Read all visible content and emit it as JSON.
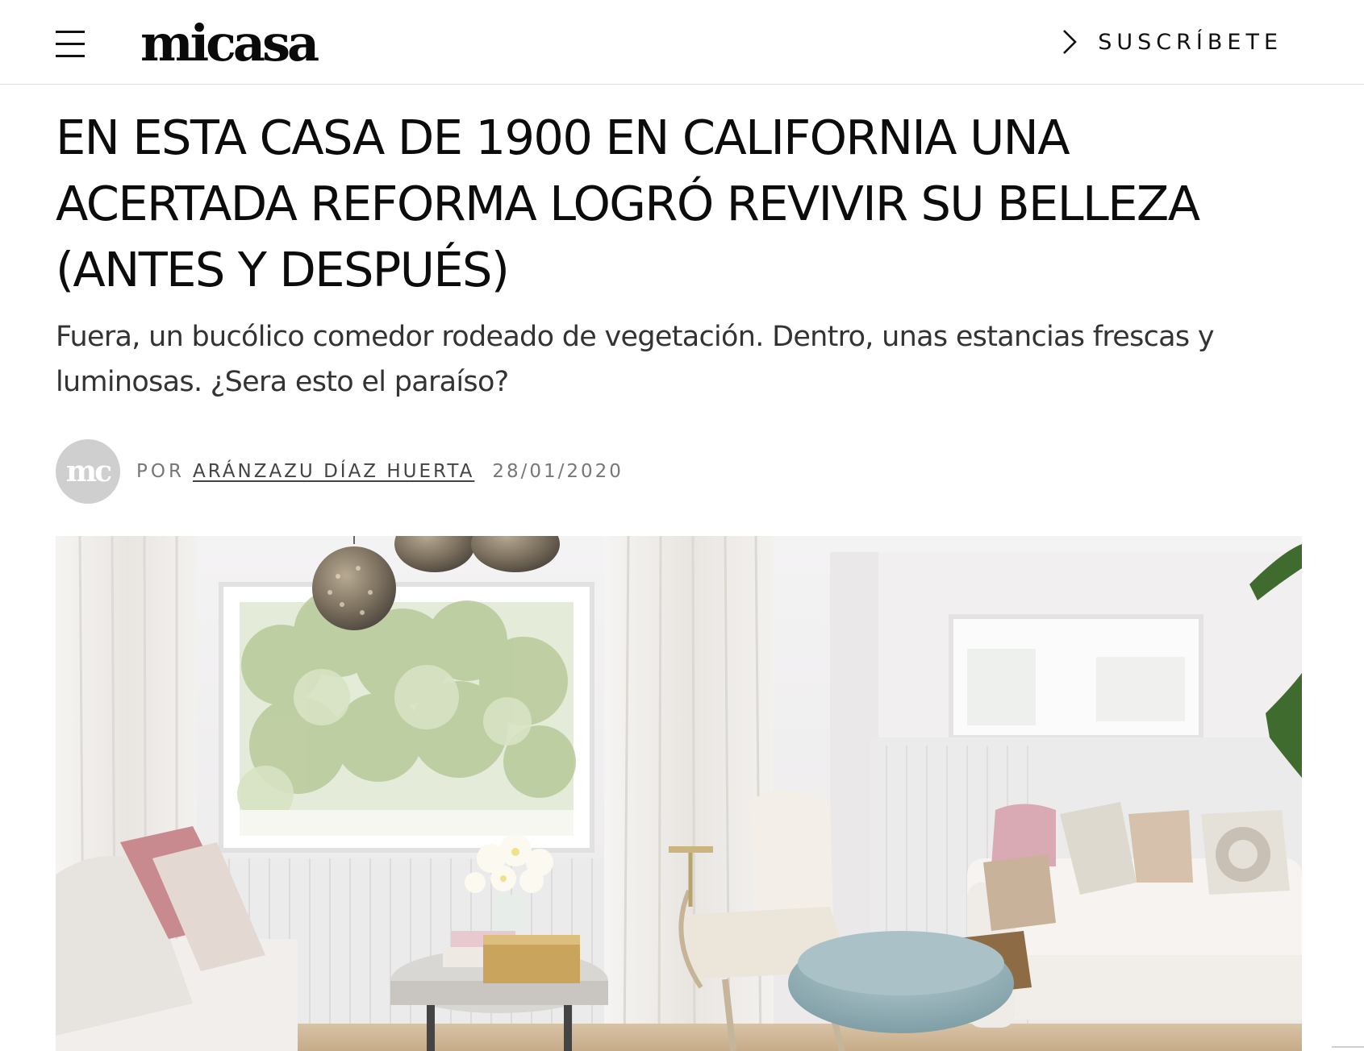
{
  "header": {
    "logo": "micasa",
    "subscribe_label": "SUSCRÍBETE"
  },
  "article": {
    "headline": "EN ESTA CASA DE 1900 EN CALIFORNIA UNA ACERTADA REFORMA LOGRÓ REVIVIR SU BELLEZA (ANTES Y DESPUÉS)",
    "dek": "Fuera, un bucólico comedor rodeado de vegetación. Dentro, unas estancias frescas y luminosas. ¿Sera esto el paraíso?",
    "byline": {
      "avatar_text": "mc",
      "prefix": "POR",
      "author": "ARÁNZAZU DÍAZ HUERTA",
      "date": "28/01/2020"
    }
  },
  "icons": {
    "menu": "hamburger-menu-icon",
    "subscribe": "chevron-right-icon"
  },
  "colors": {
    "text": "#111111",
    "muted": "#777777",
    "avatar_bg": "#cfcfcf",
    "divider": "#dcdcdc"
  }
}
